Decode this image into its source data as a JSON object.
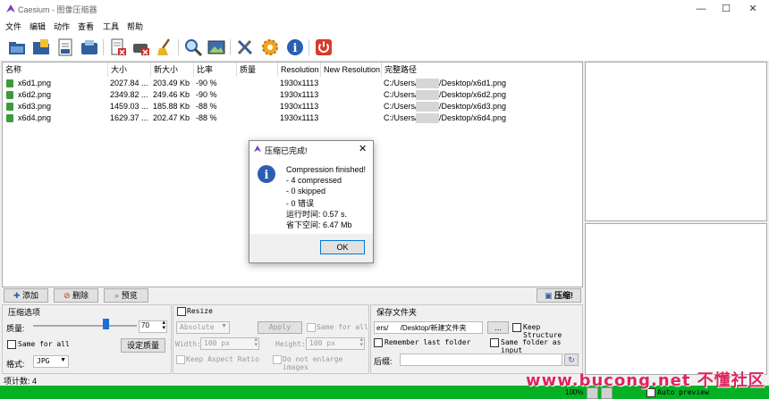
{
  "window": {
    "title": "Caesium - 图像压缩器",
    "minimize": "—",
    "maximize": "☐",
    "close": "✕"
  },
  "menu": [
    "文件",
    "编辑",
    "动作",
    "查看",
    "工具",
    "帮助"
  ],
  "toolbar": {
    "icons": [
      "open-folder-icon",
      "open-images-icon",
      "save-list-icon",
      "export-icon",
      "remove-item-icon",
      "clear-list-icon",
      "clean-icon",
      "search-icon",
      "preview-icon",
      "tools-icon",
      "settings-gear-icon",
      "info-icon",
      "power-exit-icon"
    ]
  },
  "table": {
    "columns": [
      "名称",
      "大小",
      "新大小",
      "比率",
      "质量",
      "Resolution",
      "New Resolution",
      "完整路径"
    ],
    "rows": [
      {
        "name": "x6d1.png",
        "size": "2027.84 ...",
        "new_size": "203.49 Kb",
        "ratio": "-90 %",
        "quality": "",
        "resolution": "1930x1113",
        "new_resolution": "",
        "path_prefix": "C:/Users/",
        "path_suffix": "/Desktop/x6d1.png"
      },
      {
        "name": "x6d2.png",
        "size": "2349.82 ...",
        "new_size": "249.46 Kb",
        "ratio": "-90 %",
        "quality": "",
        "resolution": "1930x1113",
        "new_resolution": "",
        "path_prefix": "C:/Users/",
        "path_suffix": "/Desktop/x6d2.png"
      },
      {
        "name": "x6d3.png",
        "size": "1459.03 ...",
        "new_size": "185.88 Kb",
        "ratio": "-88 %",
        "quality": "",
        "resolution": "1930x1113",
        "new_resolution": "",
        "path_prefix": "C:/Users/",
        "path_suffix": "/Desktop/x6d3.png"
      },
      {
        "name": "x6d4.png",
        "size": "1629.37 ...",
        "new_size": "202.47 Kb",
        "ratio": "-88 %",
        "quality": "",
        "resolution": "1930x1113",
        "new_resolution": "",
        "path_prefix": "C:/Users/",
        "path_suffix": "/Desktop/x6d4.png"
      }
    ]
  },
  "actions": {
    "add": "添加",
    "remove": "删除",
    "preview": "预览",
    "compress": "压缩!"
  },
  "compression": {
    "group_title": "压缩选项",
    "quality_label": "质量:",
    "quality_value": "70",
    "quality_level": 0.7,
    "same_for_all": "Same for all",
    "set_quality": "设定质量",
    "format_label": "格式:",
    "format_value": "JPG"
  },
  "resize": {
    "title": "Resize",
    "mode": "Absolute",
    "apply": "Apply",
    "same_for_all": "Same for all",
    "width_label": "Width:",
    "width_value": "100 px",
    "height_label": "Height:",
    "height_value": "100 px",
    "keep_aspect": "Keep Aspect Ratio",
    "no_enlarge": "Do not enlarge images"
  },
  "output": {
    "title": "保存文件夹",
    "folder_value": "ers/      /Desktop/新建文件夹",
    "browse": "...",
    "keep_structure": "Keep Structure",
    "remember_last": "Remember last folder",
    "same_as_input": "Same folder as input",
    "suffix_label": "后缀:",
    "suffix_value": ""
  },
  "status": {
    "item_count": "项计数: 4",
    "progress_percent": 100,
    "progress_label": "100%",
    "auto_preview": "Auto preview"
  },
  "dialog": {
    "title": "压缩已完成!",
    "lines": [
      "Compression finished!",
      "- 4 compressed",
      "- 0 skipped",
      "- 0 错误",
      "运行时间: 0.57 s.",
      "省下空间: 6.47 Mb"
    ],
    "ok": "OK"
  },
  "watermark": "www.bucong.net 不懂社区",
  "colors": {
    "accent": "#06b025",
    "info_blue": "#2b5fb4",
    "power_red": "#d83b2b",
    "file_icon_green": "#3c9c3c"
  }
}
